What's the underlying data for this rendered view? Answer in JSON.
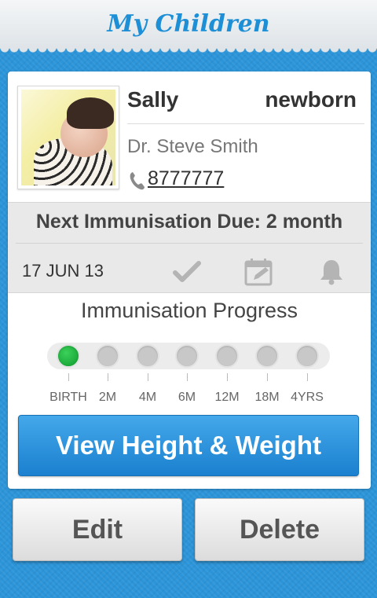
{
  "header": {
    "title": "My Children"
  },
  "child": {
    "name": "Sally",
    "age": "newborn",
    "doctor": "Dr. Steve Smith",
    "phone": "8777777"
  },
  "immunisation": {
    "next_due_label": "Next Immunisation Due: 2 month",
    "date": "17 JUN 13"
  },
  "progress": {
    "title": "Immunisation Progress",
    "stages": [
      {
        "label": "BIRTH",
        "done": true
      },
      {
        "label": "2M",
        "done": false
      },
      {
        "label": "4M",
        "done": false
      },
      {
        "label": "6M",
        "done": false
      },
      {
        "label": "12M",
        "done": false
      },
      {
        "label": "18M",
        "done": false
      },
      {
        "label": "4YRS",
        "done": false
      }
    ]
  },
  "buttons": {
    "height_weight": "View Height & Weight",
    "edit": "Edit",
    "delete": "Delete"
  },
  "icons": {
    "phone": "phone-icon",
    "check": "checkmark-icon",
    "calendar": "calendar-edit-icon",
    "bell": "bell-icon"
  },
  "colors": {
    "accent": "#1d8fd6",
    "progress_done": "#1aa83a",
    "background": "#2c95d9"
  }
}
